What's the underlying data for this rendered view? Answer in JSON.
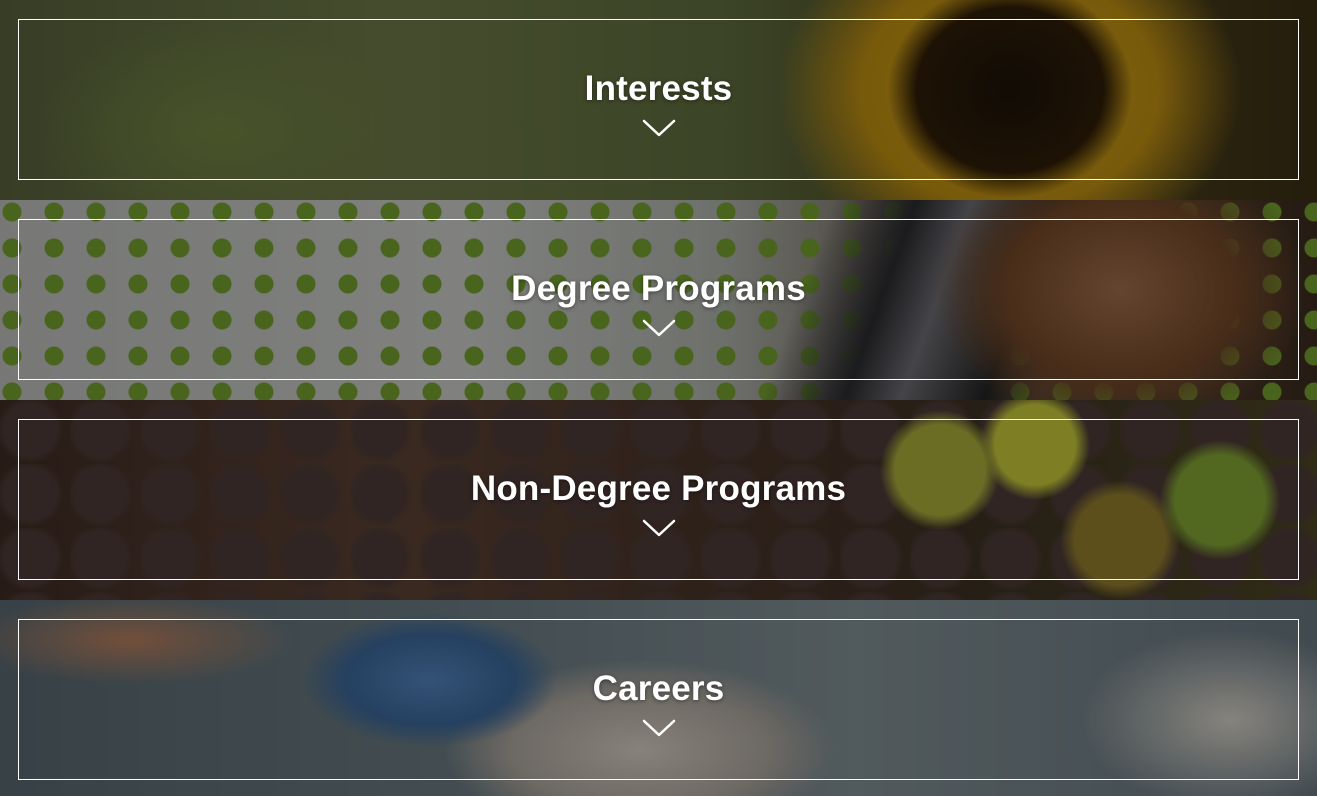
{
  "panels": [
    {
      "title": "Interests",
      "icon": "chevron-down-icon"
    },
    {
      "title": "Degree Programs",
      "icon": "chevron-down-icon"
    },
    {
      "title": "Non-Degree Programs",
      "icon": "chevron-down-icon"
    },
    {
      "title": "Careers",
      "icon": "chevron-down-icon"
    }
  ],
  "colors": {
    "text": "#ffffff",
    "border": "#ffffff",
    "overlay": "rgba(0,0,0,0.35)"
  }
}
